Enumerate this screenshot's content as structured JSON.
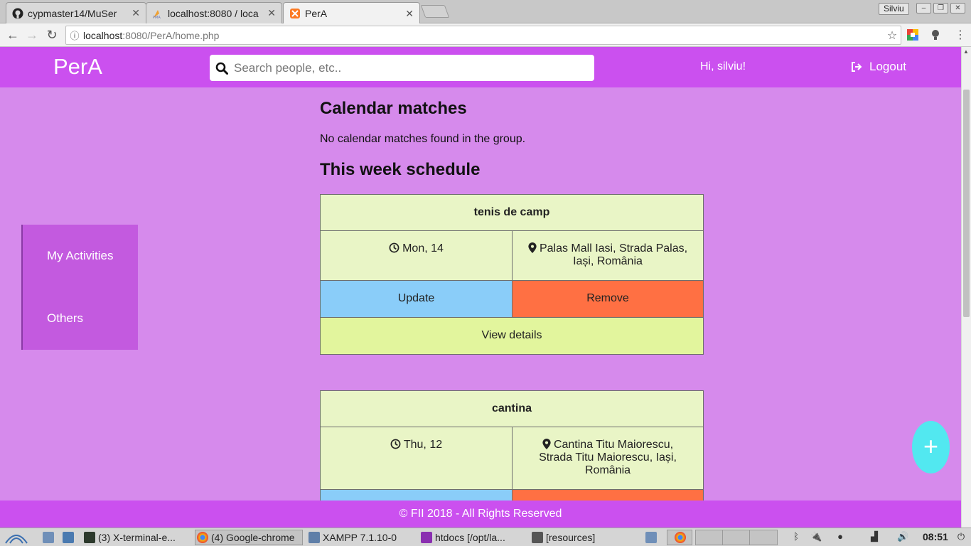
{
  "browser": {
    "tabs": [
      {
        "title": "cypmaster14/MuSer",
        "icon": "github-icon"
      },
      {
        "title": "localhost:8080 / loca",
        "icon": "phpmyadmin-icon"
      },
      {
        "title": "PerA",
        "icon": "xampp-icon",
        "active": true
      }
    ],
    "user_badge": "Silviu",
    "url_host": "localhost",
    "url_rest": ":8080/PerA/home.php"
  },
  "header": {
    "brand": "PerA",
    "search_placeholder": "Search people, etc..",
    "greeting": "Hi, silviu!",
    "logout_label": "Logout"
  },
  "sidebar": {
    "items": [
      {
        "label": "My Activities"
      },
      {
        "label": "Others"
      }
    ]
  },
  "main": {
    "calendar_heading": "Calendar matches",
    "calendar_empty": "No calendar matches found in the group.",
    "schedule_heading": "This week schedule",
    "activities": [
      {
        "title": "tenis de camp",
        "day": "Mon, 14",
        "location_line1": "Palas Mall Iasi, Strada Palas,",
        "location_line2": "Iași, România",
        "update_label": "Update",
        "remove_label": "Remove",
        "view_label": "View details"
      },
      {
        "title": "cantina",
        "day": "Thu, 12",
        "location_line1": "Cantina Titu Maiorescu,",
        "location_line2": "Strada Titu Maiorescu, Iași,",
        "location_line3": "România"
      }
    ]
  },
  "fab": {
    "label": "+"
  },
  "footer": {
    "text": "FII 2018 - All Rights Reserved"
  },
  "taskbar": {
    "items": [
      {
        "label": "(3) X-terminal-e..."
      },
      {
        "label": "(4) Google-chrome"
      },
      {
        "label": "XAMPP 7.1.10-0"
      },
      {
        "label": "htdocs [/opt/la..."
      },
      {
        "label": "[resources]"
      }
    ],
    "clock": "08:51"
  },
  "colors": {
    "header": "#cb50ef",
    "page_bg": "#d68aec",
    "sidebar": "#c35adf",
    "card": "#e9f5c6",
    "update": "#8acdf9",
    "remove": "#ff7043",
    "view": "#e2f59d",
    "fab": "#52e8f0"
  }
}
